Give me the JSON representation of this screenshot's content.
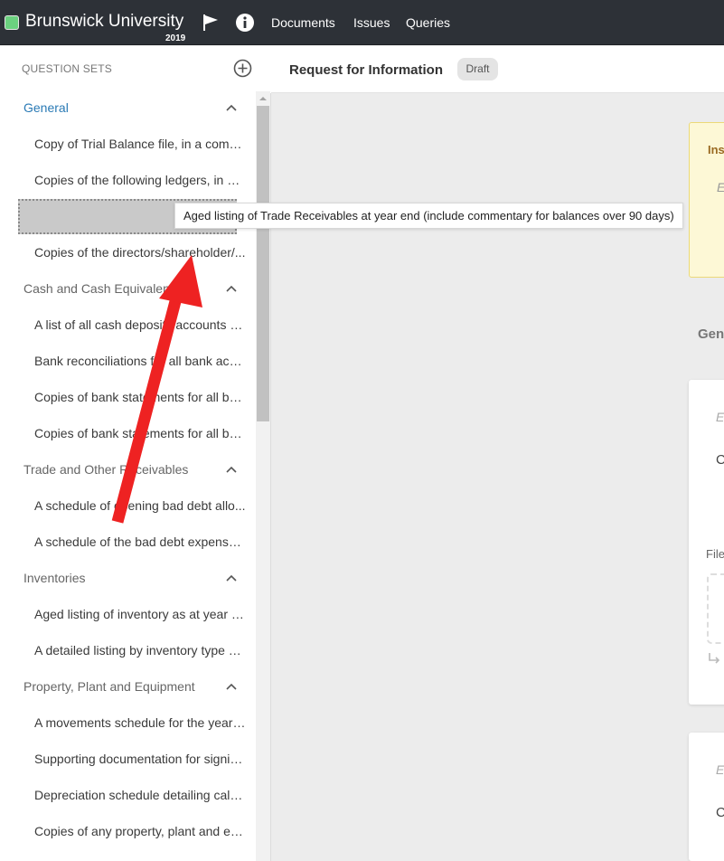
{
  "app": {
    "brand_name": "Brunswick University",
    "brand_year": "2019",
    "brand_color": "#6bd17f",
    "nav": [
      "Documents",
      "Issues",
      "Queries"
    ]
  },
  "sidebar": {
    "header": "QUESTION SETS",
    "sections": [
      {
        "label": "General",
        "active": true,
        "items": [
          "Copy of Trial Balance file, in a compa...",
          "Copies of the following ledgers, in a c...",
          "",
          "Copies of the directors/shareholder/..."
        ]
      },
      {
        "label": "Cash and Cash Equivalents",
        "items": [
          "A list of all cash deposits/accounts h...",
          "Bank reconciliations for all bank acc...",
          "Copies of bank statements for all ba...",
          "Copies of bank statements for all ba..."
        ]
      },
      {
        "label": "Trade and Other Receivables",
        "items": [
          "A schedule of opening bad debt allo...",
          "A schedule of the bad debt expense f..."
        ]
      },
      {
        "label": "Inventories",
        "items": [
          "Aged listing of inventory as at year e...",
          "A detailed listing by inventory type a..."
        ]
      },
      {
        "label": "Property, Plant and Equipment",
        "items": [
          "A movements schedule for the year ...",
          "Supporting documentation for signifi...",
          "Depreciation schedule detailing calc...",
          "Copies of any property, plant and eq..."
        ]
      }
    ],
    "drag_tooltip": "Aged listing of Trade Receivables at year end (include commentary for balances over 90 days)"
  },
  "main": {
    "title": "Request for Information",
    "status_badge": "Draft",
    "info_box_title": "Ins",
    "info_box_text": "E",
    "section_label": "Gen",
    "cards": [
      {
        "e": "E",
        "c": "C",
        "files_label": "File"
      },
      {
        "e": "E",
        "c": "C"
      }
    ]
  },
  "colors": {
    "topbar": "#2d3137",
    "accent": "#2a7ab5",
    "annotation_arrow": "#ee2222"
  }
}
